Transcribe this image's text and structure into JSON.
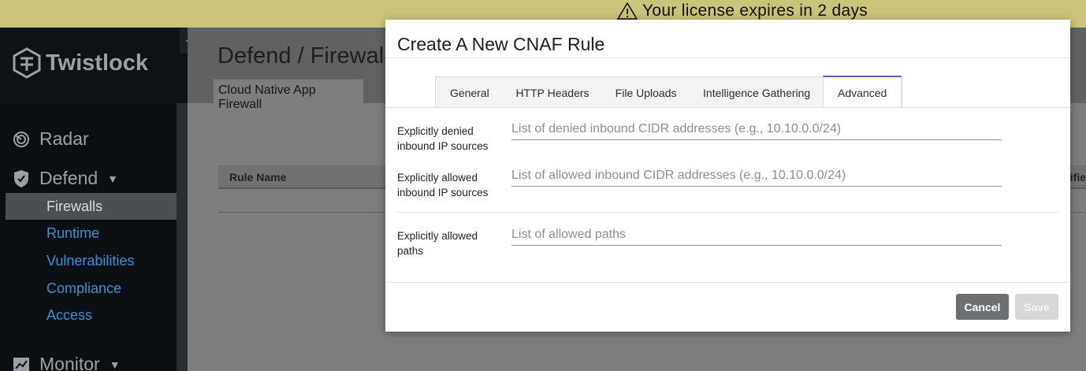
{
  "banner": {
    "text": "Your license expires in 2 days",
    "icon": "warning-icon"
  },
  "app": {
    "name": "Twistlock"
  },
  "sidebar": {
    "collapse_icon": "◀",
    "sections": [
      {
        "label": "Radar",
        "icon": "radar-icon"
      },
      {
        "label": "Defend",
        "icon": "shield-icon",
        "caret": "▼"
      },
      {
        "label": "Monitor",
        "icon": "monitor-icon",
        "caret": "▼"
      }
    ],
    "defend_items": [
      "Firewalls",
      "Runtime",
      "Vulnerabilities",
      "Compliance",
      "Access"
    ]
  },
  "page": {
    "title": "Defend / Firewalls",
    "subtab": "Cloud Native App Firewall",
    "table": {
      "col_rule_name": "Rule Name",
      "col_partial": "difie"
    }
  },
  "modal": {
    "title": "Create A New CNAF Rule",
    "tabs": [
      "General",
      "HTTP Headers",
      "File Uploads",
      "Intelligence Gathering",
      "Advanced"
    ],
    "active_tab": "Advanced",
    "fields": [
      {
        "label": "Explicitly denied inbound IP sources",
        "placeholder": "List of denied inbound CIDR addresses (e.g., 10.10.0.0/24)"
      },
      {
        "label": "Explicitly allowed inbound IP sources",
        "placeholder": "List of allowed inbound CIDR addresses (e.g., 10.10.0.0/24)"
      },
      {
        "label": "Explicitly allowed paths",
        "placeholder": "List of allowed paths"
      }
    ],
    "buttons": {
      "cancel": "Cancel",
      "save": "Save"
    }
  },
  "colors": {
    "accent": "#6b4fc9",
    "link": "#3d8fd1",
    "banner": "#c8c47a"
  }
}
